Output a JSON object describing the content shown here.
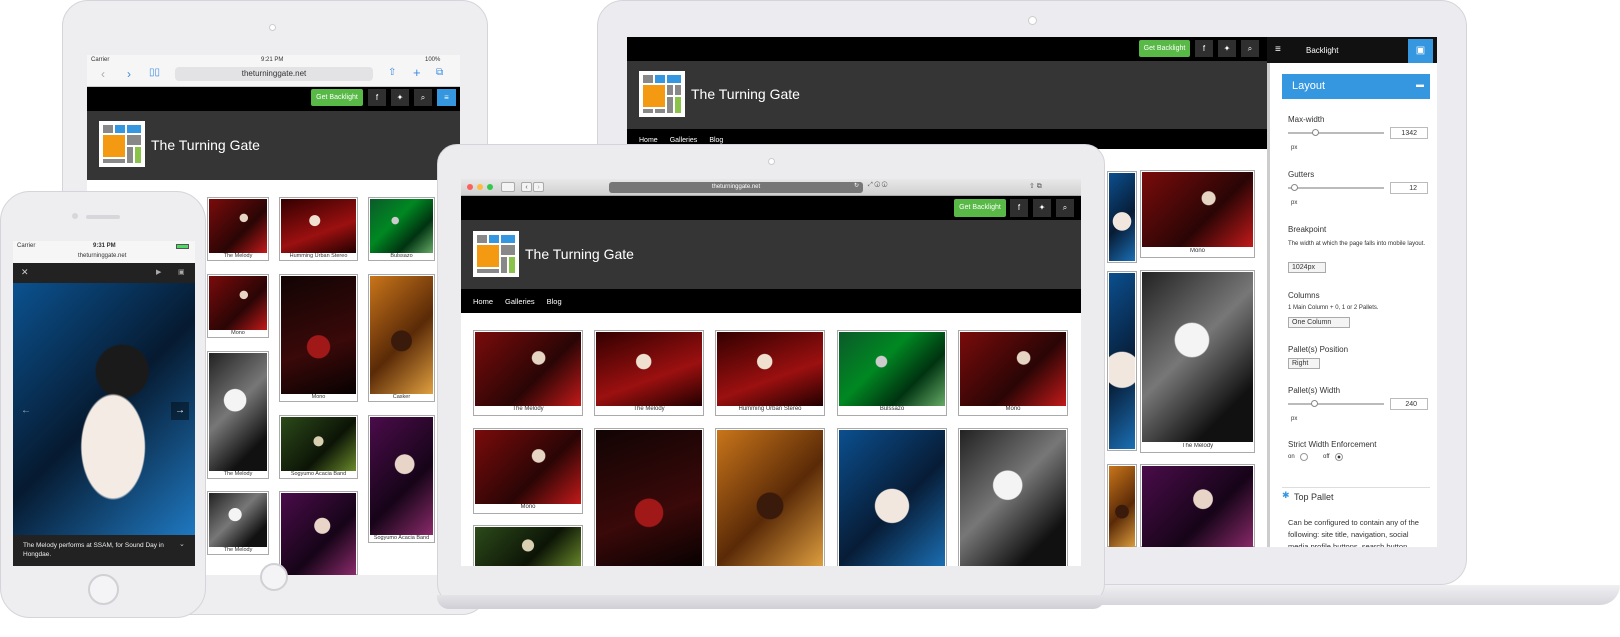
{
  "site": {
    "title": "The Turning Gate",
    "domain": "theturninggate.net",
    "cta": "Get Backlight",
    "nav": [
      "Home",
      "Galleries",
      "Blog"
    ]
  },
  "icons": {
    "facebook": "f",
    "twitter": "twitter-bird",
    "search": "magnifier",
    "menu": "hamburger",
    "save": "floppy-disk",
    "gear": "cog"
  },
  "colors": {
    "accent_green": "#58b947",
    "accent_blue": "#3497e0",
    "header_bg": "#353535",
    "topbar_bg": "#000000"
  },
  "laptop_grid": {
    "row1": [
      "The Melody",
      "The Melody",
      "Humming Urban Stereo",
      "Bulssazo",
      "Mono"
    ],
    "row2": [
      "Mono",
      "",
      "",
      "",
      ""
    ]
  },
  "tablet_grid": {
    "row1": [
      "The Melody",
      "Humming Urban Stereo",
      "Bulssazo"
    ],
    "row2": [
      "Mono",
      "Mono",
      "Casker"
    ],
    "row3": [
      "The Melody",
      "Sogyumo Acacia Band",
      "Sogyumo Acacia Band"
    ],
    "row4": [
      "The Melody",
      "",
      ""
    ]
  },
  "tablet_status": {
    "carrier": "Carrier",
    "time": "9:21 PM",
    "battery": "100%"
  },
  "phone": {
    "carrier": "Carrier",
    "time": "9:31 PM",
    "domain": "theturninggate.net",
    "caption": "The Melody performs at SSAM, for Sound Day in Hongdae."
  },
  "desktop": {
    "panel_title": "Backlight",
    "grid_right": [
      "Mono",
      "The Melody"
    ],
    "layout_section": "Layout",
    "fields": {
      "max_width": {
        "label": "Max-width",
        "value": "1342",
        "unit": "px"
      },
      "gutters": {
        "label": "Gutters",
        "value": "12",
        "unit": "px"
      },
      "breakpoint": {
        "label": "Breakpoint",
        "help": "The width at which the page falls into mobile layout.",
        "value": "1024px"
      },
      "columns": {
        "label": "Columns",
        "help": "1 Main Column + 0, 1 or 2 Pallets.",
        "value": "One Column"
      },
      "pallet_position": {
        "label": "Pallet(s) Position",
        "value": "Right"
      },
      "pallet_width": {
        "label": "Pallet(s) Width",
        "value": "240",
        "unit": "px"
      },
      "strict_width": {
        "label": "Strict Width Enforcement",
        "on": "on",
        "off": "off"
      }
    },
    "top_pallet": {
      "label": "Top Pallet",
      "text": "Can be configured to contain any of the following: site title, navigation, social media profile buttons, search button"
    }
  }
}
